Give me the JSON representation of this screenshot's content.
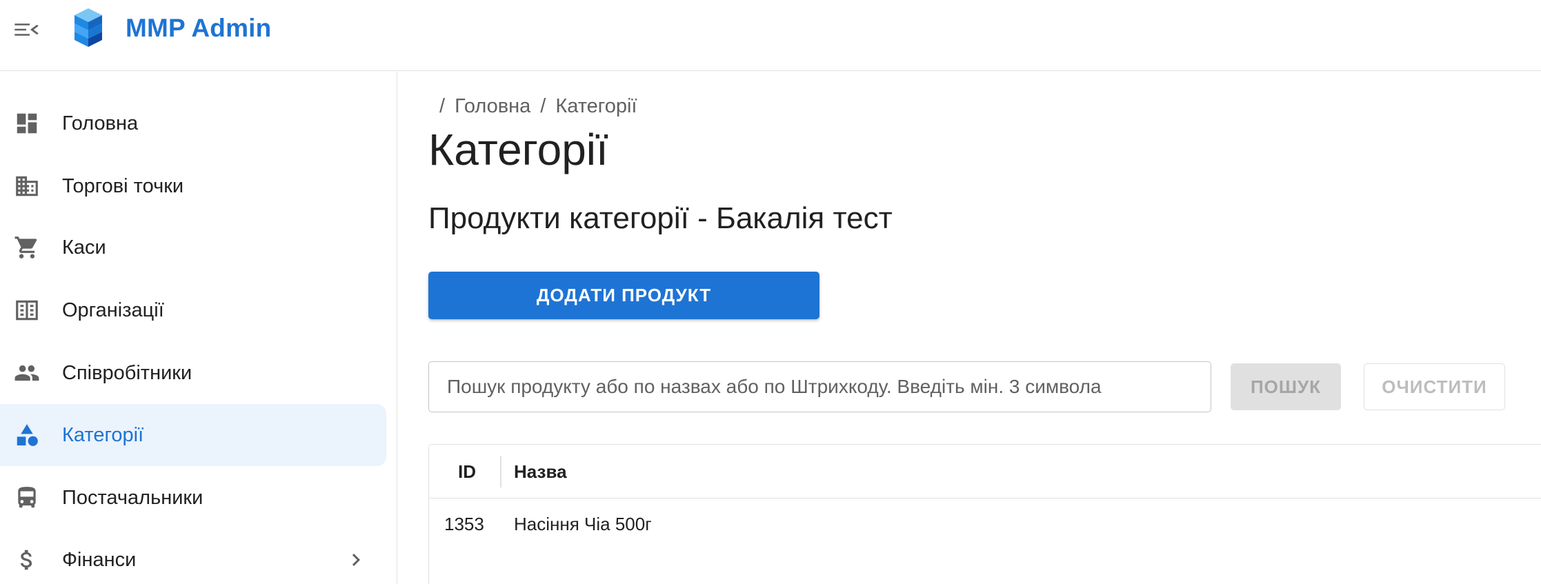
{
  "header": {
    "title": "MMP Admin",
    "menu_icon": "menu-open-icon",
    "logo_icon": "cubes-logo-icon",
    "brand_color": "#1e74d4"
  },
  "sidebar": {
    "items": [
      {
        "label": "Головна",
        "icon": "dashboard-icon",
        "active": false
      },
      {
        "label": "Торгові точки",
        "icon": "domain-icon",
        "active": false
      },
      {
        "label": "Каси",
        "icon": "cart-icon",
        "active": false
      },
      {
        "label": "Організації",
        "icon": "corporate-icon",
        "active": false
      },
      {
        "label": "Співробітники",
        "icon": "people-icon",
        "active": false
      },
      {
        "label": "Категорії",
        "icon": "category-icon",
        "active": true
      },
      {
        "label": "Постачальники",
        "icon": "bus-icon",
        "active": false
      },
      {
        "label": "Фінанси",
        "icon": "dollar-icon",
        "active": false,
        "has_submenu": true
      }
    ],
    "active_bg": "#ebf3fc"
  },
  "main": {
    "breadcrumb": [
      "Головна",
      "Категорії"
    ],
    "title": "Категорії",
    "subtitle": "Продукти категорії - Бакалія тест",
    "add_button_label": "ДОДАТИ ПРОДУКТ",
    "search": {
      "placeholder": "Пошук продукту або по назвах або по Штрихкоду. Введіть мін. 3 символа",
      "value": ""
    },
    "search_button_label": "ПОШУК",
    "clear_button_label": "ОЧИСТИТИ",
    "table": {
      "columns": [
        "ID",
        "Назва"
      ],
      "rows": [
        {
          "id": "1353",
          "name": "Насіння Чіа 500г"
        }
      ]
    }
  }
}
